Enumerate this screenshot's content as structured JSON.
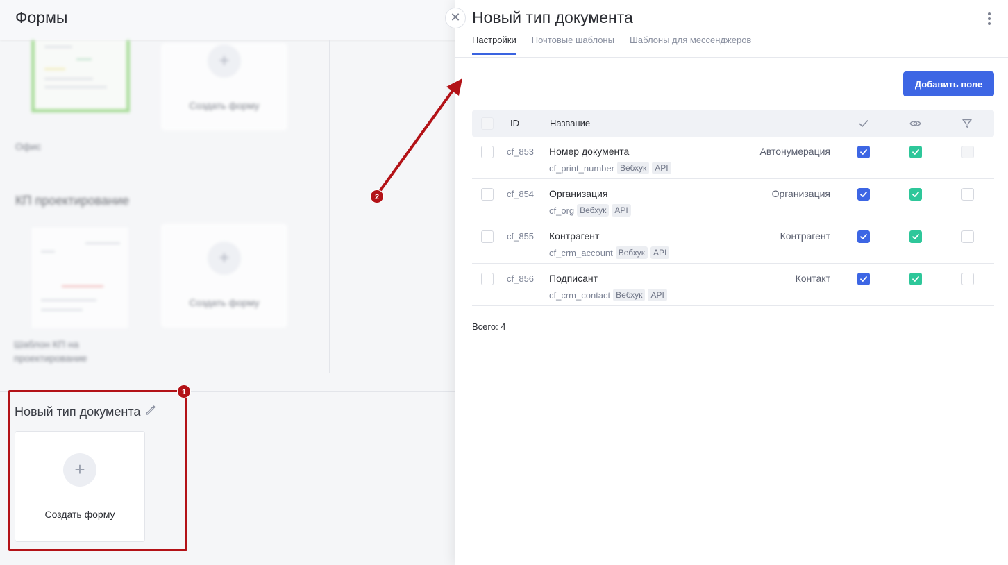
{
  "background": {
    "page_title": "Формы",
    "section1_caption": "Офис",
    "section2_title": "КП проектирование",
    "section2_caption": "Шаблон КП на проектирование",
    "create_form_label": "Создать форму",
    "new_section": {
      "title": "Новый тип документа",
      "create_form_label": "Создать форму"
    }
  },
  "annotations": {
    "badge1": "1",
    "badge2": "2",
    "highlight_color": "#b31217"
  },
  "drawer": {
    "title": "Новый тип документа",
    "tabs": [
      {
        "label": "Настройки",
        "active": true
      },
      {
        "label": "Почтовые шаблоны",
        "active": false
      },
      {
        "label": "Шаблоны для мессенджеров",
        "active": false
      }
    ],
    "add_field_button": "Добавить поле",
    "table": {
      "headers": {
        "id": "ID",
        "name": "Название",
        "col_check_icon": "check-icon",
        "col_eye_icon": "eye-icon",
        "col_filter_icon": "filter-icon"
      },
      "rows": [
        {
          "id": "cf_853",
          "name": "Номер документа",
          "code": "cf_print_number",
          "tags": [
            "Вебхук",
            "API"
          ],
          "type": "Автонумерация",
          "required": true,
          "visible": true,
          "filter": false,
          "filter_disabled": true
        },
        {
          "id": "cf_854",
          "name": "Организация",
          "code": "cf_org",
          "tags": [
            "Вебхук",
            "API"
          ],
          "type": "Организация",
          "required": true,
          "visible": true,
          "filter": false,
          "filter_disabled": false
        },
        {
          "id": "cf_855",
          "name": "Контрагент",
          "code": "cf_crm_account",
          "tags": [
            "Вебхук",
            "API"
          ],
          "type": "Контрагент",
          "required": true,
          "visible": true,
          "filter": false,
          "filter_disabled": false
        },
        {
          "id": "cf_856",
          "name": "Подписант",
          "code": "cf_crm_contact",
          "tags": [
            "Вебхук",
            "API"
          ],
          "type": "Контакт",
          "required": true,
          "visible": true,
          "filter": false,
          "filter_disabled": false
        }
      ]
    },
    "total_label": "Всего: 4",
    "colors": {
      "accent": "#3d66e4",
      "green": "#2ec79a"
    }
  }
}
